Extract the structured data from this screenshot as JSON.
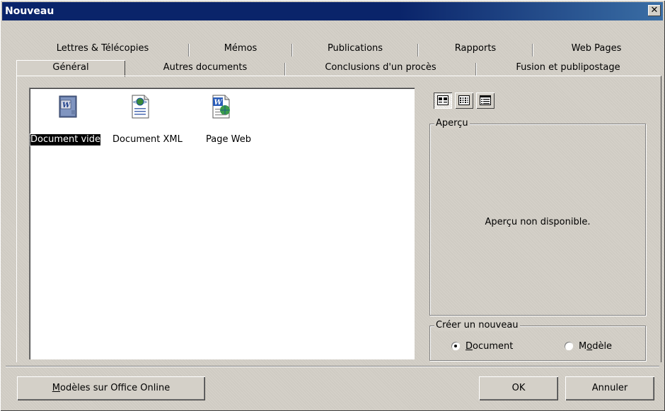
{
  "window": {
    "title": "Nouveau",
    "close_glyph": "✕"
  },
  "tabs_back": [
    "Lettres & Télécopies",
    "Mémos",
    "Publications",
    "Rapports",
    "Web Pages"
  ],
  "tabs_front": [
    "Général",
    "Autres documents",
    "Conclusions d'un procès",
    "Fusion et publipostage"
  ],
  "active_tab": "Général",
  "templates": [
    {
      "label": "Document vide",
      "icon": "word-document-icon",
      "selected": true
    },
    {
      "label": "Document XML",
      "icon": "xml-document-icon",
      "selected": false
    },
    {
      "label": "Page Web",
      "icon": "web-page-icon",
      "selected": false
    }
  ],
  "view_buttons": [
    {
      "icon": "large-icons-view-icon",
      "pressed": true
    },
    {
      "icon": "list-view-icon",
      "pressed": false
    },
    {
      "icon": "details-view-icon",
      "pressed": false
    }
  ],
  "preview": {
    "legend": "Aperçu",
    "message": "Aperçu non disponible."
  },
  "create_new": {
    "legend": "Créer un nouveau",
    "option_document": {
      "pre": "",
      "accel": "D",
      "post": "ocument",
      "checked": true
    },
    "option_template": {
      "pre": "M",
      "accel": "o",
      "post": "dèle",
      "checked": false
    }
  },
  "buttons": {
    "office_online": {
      "accel": "M",
      "rest": "odèles sur Office Online"
    },
    "ok": "OK",
    "cancel": "Annuler"
  }
}
